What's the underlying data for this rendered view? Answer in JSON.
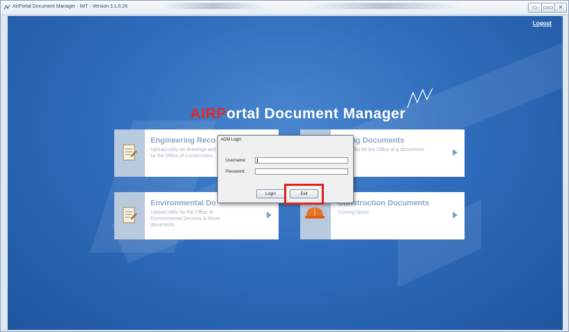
{
  "window": {
    "title": "AirPortal Document Manager - IMT - Version 3.1.0.26",
    "buttons": {
      "minimize": "▭",
      "maximize": "▭▭",
      "close": "✕"
    }
  },
  "header": {
    "logout_label": "Logout"
  },
  "brand": {
    "highlight": "AIRP",
    "rest": "ortal Document Manager"
  },
  "cards": [
    {
      "title": "Engineering Reco",
      "description": "Upload utility for drawings and reports for the Office of Construction.",
      "icon": "document-icon"
    },
    {
      "title": "ing Documents",
      "description": "utility for the Office of g documents.",
      "icon": "document-icon"
    },
    {
      "title": "Environmental Do",
      "description": "Upload utility for the Office of Environmental Services & Noise documents.",
      "icon": "document-icon"
    },
    {
      "title": "Construction Documents",
      "description": "Coming Soon!",
      "icon": "hardhat-icon"
    }
  ],
  "dialog": {
    "title": "ADM Login",
    "username_label": "Username:",
    "username_value": "",
    "password_label": "Password:",
    "password_value": "",
    "login_label": "Login",
    "exit_label": "Exit"
  },
  "colors": {
    "accent_red": "#e02b2b",
    "background_blue": "#2f6dbc",
    "highlight_box": "#e3211b"
  }
}
